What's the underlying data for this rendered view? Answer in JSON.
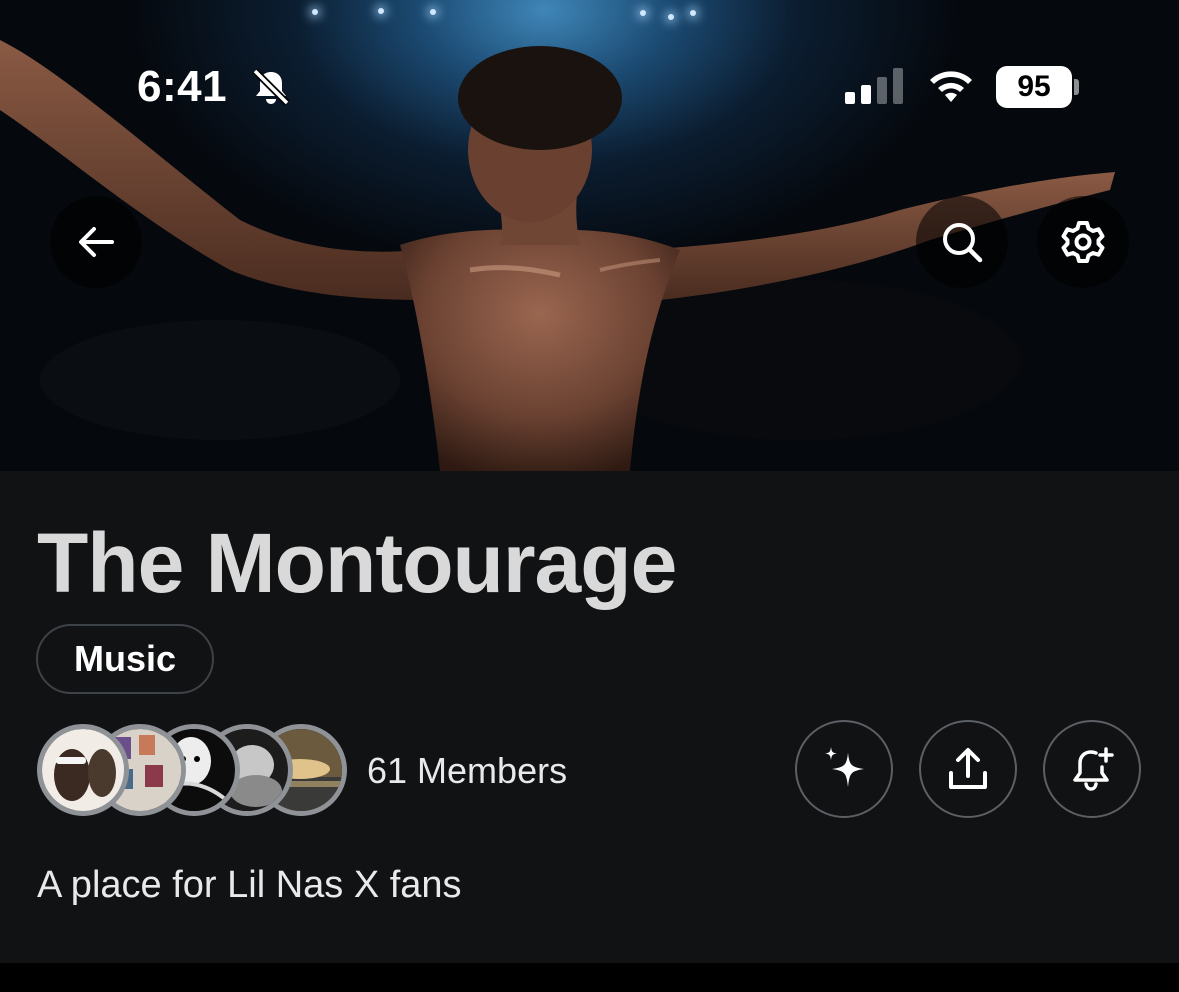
{
  "status_bar": {
    "time": "6:41",
    "battery_level": "95",
    "icons": [
      "bell-off-icon",
      "signal-icon",
      "wifi-icon",
      "battery-icon"
    ]
  },
  "header": {
    "icons": [
      "back-arrow-icon",
      "search-icon",
      "gear-icon"
    ]
  },
  "community": {
    "title": "The Montourage",
    "category": "Music",
    "members_label": "61 Members",
    "description": "A place for Lil Nas X fans"
  },
  "actions": {
    "icons": [
      "sparkle-icon",
      "share-icon",
      "bell-plus-icon"
    ]
  },
  "colors": {
    "panel_bg": "#111214",
    "title": "#d9d9d9",
    "text": "#e7e9ea",
    "border": "#3d4247"
  }
}
